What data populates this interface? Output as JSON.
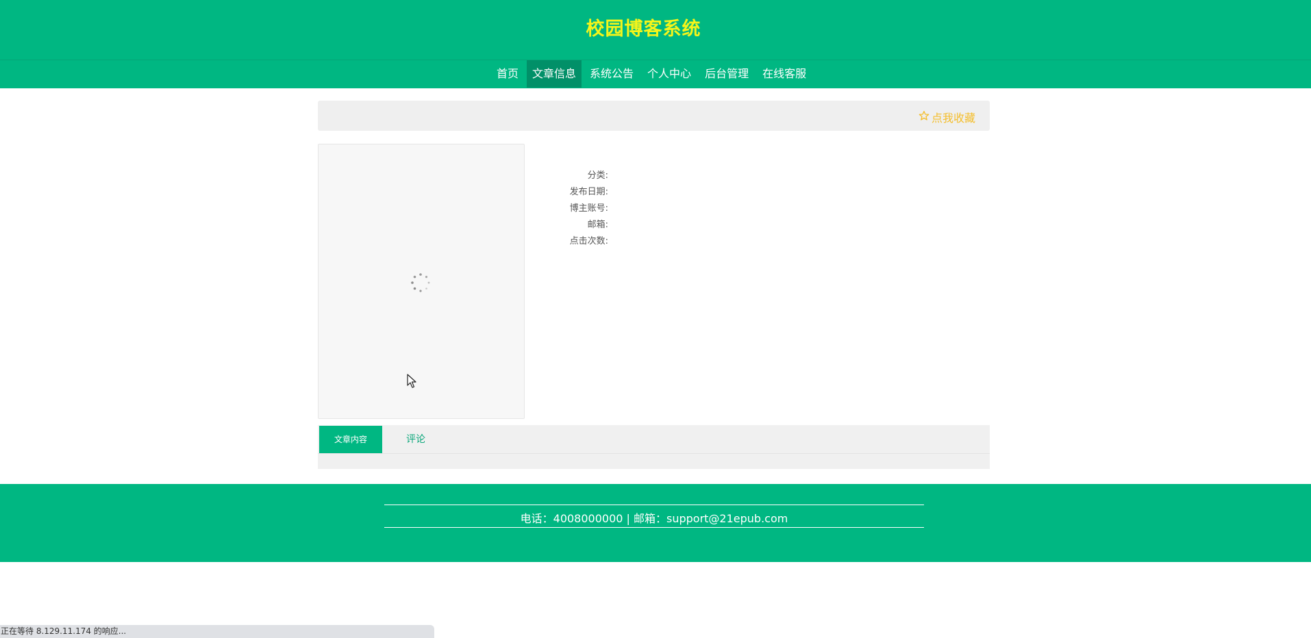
{
  "header": {
    "title": "校园博客系统"
  },
  "nav": {
    "items": [
      {
        "label": "首页"
      },
      {
        "label": "文章信息"
      },
      {
        "label": "系统公告"
      },
      {
        "label": "个人中心"
      },
      {
        "label": "后台管理"
      },
      {
        "label": "在线客服"
      }
    ],
    "active_index": 1
  },
  "favorite": {
    "label": "点我收藏",
    "icon": "star-outline-icon"
  },
  "cover": {
    "state": "loading",
    "icon": "loading-spinner-icon"
  },
  "meta": {
    "fields": [
      {
        "label": "分类:",
        "value": ""
      },
      {
        "label": "发布日期:",
        "value": ""
      },
      {
        "label": "博主账号:",
        "value": ""
      },
      {
        "label": "邮箱:",
        "value": ""
      },
      {
        "label": "点击次数:",
        "value": ""
      }
    ]
  },
  "tabs": {
    "items": [
      {
        "label": "文章内容"
      },
      {
        "label": "评论"
      }
    ],
    "active_index": 0
  },
  "footer": {
    "text": "电话：4008000000 | 邮箱：support@21epub.com"
  },
  "status_bar": {
    "text": "正在等待 8.129.11.174 的响应..."
  },
  "colors": {
    "brand_green": "#00b782",
    "active_nav": "#019068",
    "title_yellow": "#f5f51a",
    "favorite_gold": "#f4be2b"
  }
}
